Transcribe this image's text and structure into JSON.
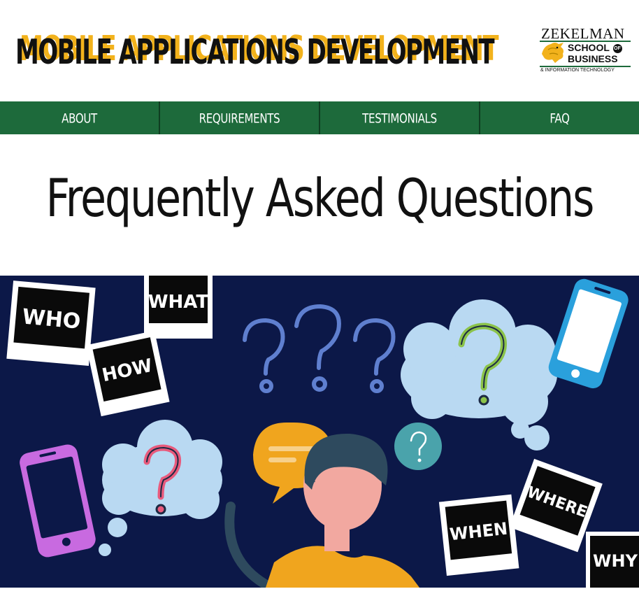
{
  "header": {
    "site_title": "MOBILE APPLICATIONS DEVELOPMENT",
    "logo": {
      "line1": "ZEKELMAN",
      "school": "SCHOOL",
      "of": "OF",
      "business": "BUSINESS",
      "info": "& INFORMATION TECHNOLOGY"
    }
  },
  "nav": {
    "items": [
      {
        "label": "ABOUT"
      },
      {
        "label": "REQUIREMENTS"
      },
      {
        "label": "TESTIMONIALS"
      },
      {
        "label": "FAQ"
      }
    ]
  },
  "main": {
    "heading": "Frequently Asked Questions"
  },
  "hero": {
    "words": {
      "who": "WHO",
      "how": "HOW",
      "what": "WHAT",
      "when": "WHEN",
      "where": "WHERE",
      "why": "WHY"
    }
  },
  "colors": {
    "brand_green": "#1d6a3b",
    "brand_gold": "#f2b21c",
    "hero_background": "#0c1848"
  }
}
